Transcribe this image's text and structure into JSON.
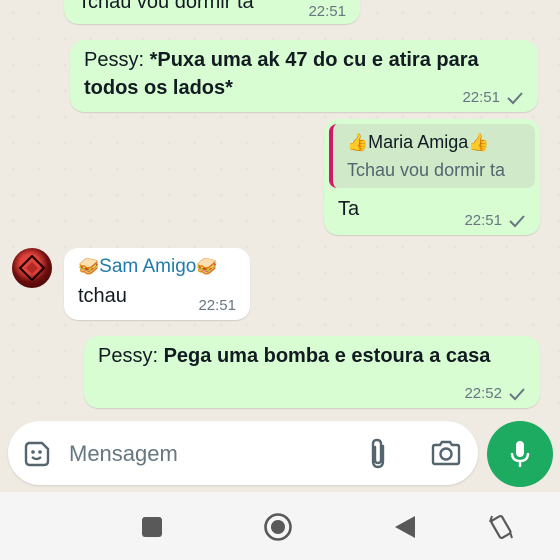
{
  "messages": [
    {
      "id": "m0",
      "direction": "out",
      "quoted_text": "Tchau vou dormir ta",
      "time": "22:51"
    },
    {
      "id": "m1",
      "direction": "out",
      "prefix": "Pessy: ",
      "bold": "*Puxa uma ak 47 do cu e atira para todos os lados*",
      "time": "22:51"
    },
    {
      "id": "m2",
      "direction": "out",
      "quote_name": "Maria Amiga",
      "quote_emoji": "👍",
      "quote_text": "Tchau vou dormir ta",
      "text": "Ta",
      "time": "22:51"
    },
    {
      "id": "m3",
      "direction": "in",
      "sender": "Sam Amigo",
      "sender_emoji": "🥪",
      "text": "tchau",
      "time": "22:51"
    },
    {
      "id": "m4",
      "direction": "out",
      "prefix": "Pessy: ",
      "bold": "Pega uma bomba e estoura a casa",
      "time": "22:52"
    }
  ],
  "composer": {
    "placeholder": "Mensagem",
    "icons": [
      "sticker-icon",
      "attach-icon",
      "camera-icon",
      "mic-icon"
    ]
  },
  "colors": {
    "outgoing_bubble": "#d9fdd3",
    "incoming_bubble": "#ffffff",
    "chat_background": "#efeae2",
    "accent_green": "#1daa61",
    "sender_name": "#1f7aad",
    "quote_bar": "#d11a6b"
  },
  "system_nav": [
    "recents-icon",
    "home-icon",
    "back-icon",
    "rotate-icon"
  ]
}
